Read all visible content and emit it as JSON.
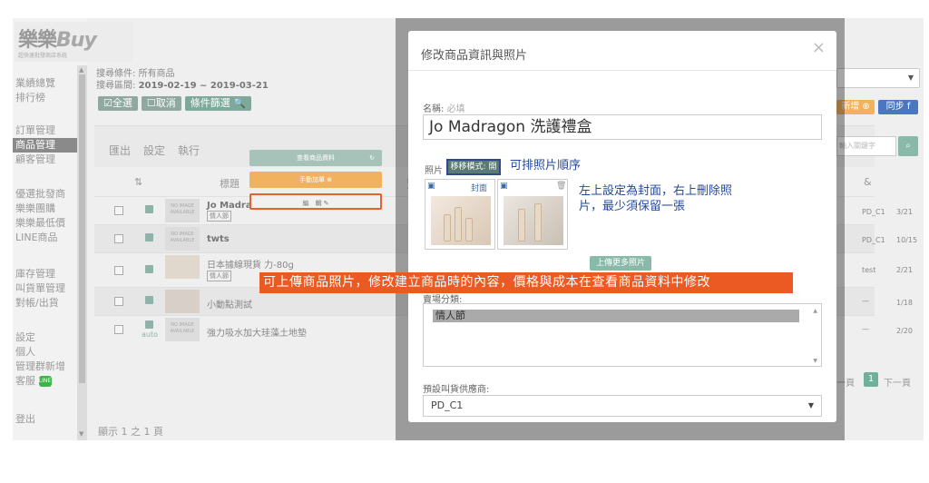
{
  "logo": {
    "text_cjk": "樂樂",
    "text_buy": "Buy",
    "subtitle": "超快速批發商店系統"
  },
  "sidebar": {
    "group1": [
      "業績總覽",
      "排行榜"
    ],
    "group2": [
      "訂單管理",
      "商品管理",
      "顧客管理"
    ],
    "group3": [
      "優選批發商",
      "樂樂團購",
      "樂樂最低價",
      "LINE商品"
    ],
    "group4": [
      "庫存管理",
      "叫貨單管理",
      "對帳/出貨"
    ],
    "group5": [
      "設定",
      "個人",
      "管理群新增",
      "客服"
    ],
    "logout": "登出",
    "line_icon_text": "LINE"
  },
  "filter": {
    "condition_label": "搜尋條件:",
    "condition_value": "所有商品",
    "range_label": "搜尋區間:",
    "range_value": "2019-02-19 ~ 2019-03-21"
  },
  "toolbar": {
    "select_all": "☑全選",
    "cancel": "☐取消",
    "filter": "條件篩選 🔍"
  },
  "tabs": {
    "export": "匯出",
    "settings": "設定",
    "execute": "執行"
  },
  "table": {
    "header_title": "標題",
    "header_sort": "⇅",
    "header_price": "賣",
    "header_amp": "&",
    "rows": [
      {
        "title": "Jo Madragon",
        "tag": "情人節",
        "col1": "PD_C1",
        "col2": "3/21",
        "img": "NO IMAGE AVAILABLE"
      },
      {
        "title": "twts",
        "tag": "",
        "col1": "PD_C1",
        "col2": "10/15",
        "img": "NO IMAGE AVAILABLE"
      },
      {
        "title": "日本據線現貨 力-80g",
        "tag": "情人節",
        "col1": "test",
        "col2": "2/21",
        "img": ""
      },
      {
        "title": "小動點測試",
        "tag": "",
        "col1": "—",
        "col2": "1/18",
        "img": ""
      },
      {
        "title": "強力吸水加大珪藻土地墊",
        "tag": "",
        "col1": "—",
        "col2": "2/20",
        "img": "NO IMAGE AVAILABLE",
        "auto": "auto"
      }
    ]
  },
  "row_menu": {
    "view": "查看商品資料",
    "add": "手動加單 ⊕",
    "edit": "編　輯 ✎"
  },
  "footer": {
    "showing": "顯示 1 之 1 頁"
  },
  "right": {
    "add": "新增 ⊕",
    "sync": "同步 f",
    "search_placeholder": "輸入關鍵字",
    "pager_prev": "一頁",
    "pager_page": "1",
    "pager_next": "下一頁"
  },
  "modal": {
    "title": "修改商品資訊與照片",
    "close": "×",
    "name_label": "名稱:",
    "name_required": "必填",
    "name_value": "Jo Madragon 洗護禮盒",
    "photo_label": "照片",
    "sort_mode": "移移模式: 開",
    "note_sort": "可排照片順序",
    "cover_label": "封面",
    "note_cover_line1": "左上設定為封面，右上刪除照",
    "note_cover_line2": "片，最少須保留一張",
    "upload_more": "上傳更多照片",
    "category_label": "賣場分類:",
    "category_option": "情人節",
    "supplier_label": "預設叫貨供應商:",
    "supplier_value": "PD_C1"
  },
  "banner": {
    "text": "可上傳商品照片，修改建立商品時的內容，價格與成本在查看商品資料中修改"
  },
  "colors": {
    "banner": "#ea5a22",
    "note_blue": "#244a9e",
    "sort_border": "#2f4b8f"
  }
}
